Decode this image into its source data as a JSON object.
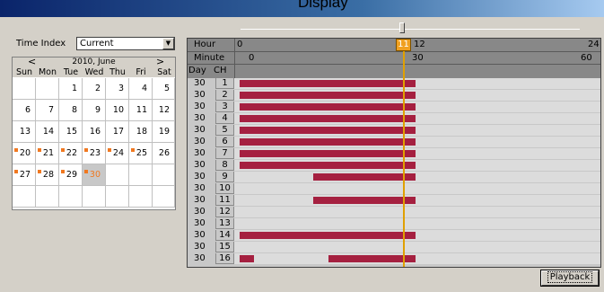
{
  "window": {
    "title": "Display"
  },
  "time_index": {
    "label": "Time Index",
    "selected": "Current"
  },
  "calendar": {
    "prev": "<",
    "next": ">",
    "month_label": "2010, June",
    "weekdays": [
      "Sun",
      "Mon",
      "Tue",
      "Wed",
      "Thu",
      "Fri",
      "Sat"
    ],
    "selected_day": "30",
    "weeks": [
      [
        "",
        "",
        "1",
        "2",
        "3",
        "4",
        "5"
      ],
      [
        "6",
        "7",
        "8",
        "9",
        "10",
        "11",
        "12"
      ],
      [
        "13",
        "14",
        "15",
        "16",
        "17",
        "18",
        "19"
      ],
      [
        "20",
        "21",
        "22",
        "23",
        "24",
        "25",
        "26"
      ],
      [
        "27",
        "28",
        "29",
        "30",
        "",
        "",
        ""
      ],
      [
        "",
        "",
        "",
        "",
        "",
        "",
        ""
      ]
    ],
    "days_with_recordings": [
      "20",
      "21",
      "22",
      "23",
      "24",
      "25",
      "27",
      "28",
      "29",
      "30"
    ]
  },
  "timeline": {
    "hour_label": "Hour",
    "minute_label": "Minute",
    "day_label": "Day",
    "ch_label": "CH",
    "hour_ticks": [
      "0",
      "12",
      "24"
    ],
    "minute_ticks": [
      "0",
      "30",
      "60"
    ],
    "current_hour": "11",
    "rows": [
      {
        "day": "30",
        "ch": "1"
      },
      {
        "day": "30",
        "ch": "2"
      },
      {
        "day": "30",
        "ch": "3"
      },
      {
        "day": "30",
        "ch": "4"
      },
      {
        "day": "30",
        "ch": "5"
      },
      {
        "day": "30",
        "ch": "6"
      },
      {
        "day": "30",
        "ch": "7"
      },
      {
        "day": "30",
        "ch": "8"
      },
      {
        "day": "30",
        "ch": "9"
      },
      {
        "day": "30",
        "ch": "10"
      },
      {
        "day": "30",
        "ch": "11"
      },
      {
        "day": "30",
        "ch": "12"
      },
      {
        "day": "30",
        "ch": "13"
      },
      {
        "day": "30",
        "ch": "14"
      },
      {
        "day": "30",
        "ch": "15"
      },
      {
        "day": "30",
        "ch": "16"
      }
    ]
  },
  "colors": {
    "recording": "#a52040",
    "cursor": "#e0a000",
    "calendar_mark": "#f07820"
  },
  "buttons": {
    "playback": "Playback"
  }
}
